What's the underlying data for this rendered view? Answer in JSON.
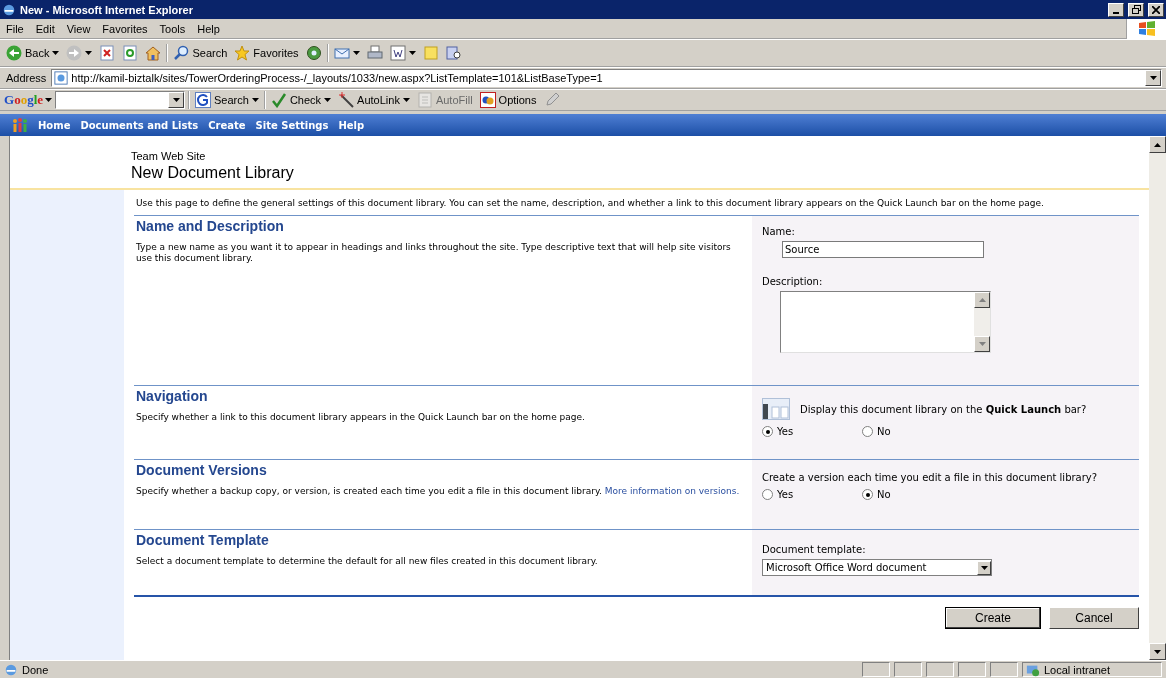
{
  "window": {
    "title": "New - Microsoft Internet Explorer"
  },
  "menu": [
    "File",
    "Edit",
    "View",
    "Favorites",
    "Tools",
    "Help"
  ],
  "toolbar": [
    {
      "kind": "back",
      "label": "Back",
      "dropdown": true
    },
    {
      "kind": "forward",
      "dropdown": true
    },
    {
      "kind": "stop",
      "dropdown": false
    },
    {
      "kind": "refresh",
      "dropdown": false
    },
    {
      "kind": "home",
      "dropdown": false
    },
    {
      "kind": "separator"
    },
    {
      "kind": "search",
      "label": "Search",
      "dropdown": false
    },
    {
      "kind": "favorites",
      "label": "Favorites",
      "dropdown": false
    },
    {
      "kind": "media",
      "dropdown": false
    },
    {
      "kind": "separator"
    },
    {
      "kind": "mail",
      "dropdown": true
    },
    {
      "kind": "print",
      "dropdown": false
    },
    {
      "kind": "word",
      "dropdown": true
    },
    {
      "kind": "note",
      "dropdown": false
    },
    {
      "kind": "research",
      "dropdown": false
    }
  ],
  "address": {
    "label": "Address",
    "url": "http://kamil-biztalk/sites/TowerOrderingProcess-/_layouts/1033/new.aspx?ListTemplate=101&ListBaseType=1"
  },
  "google_toolbar": {
    "logo": "Google",
    "items": [
      {
        "kind": "search",
        "label": "Search",
        "dropdown": true,
        "disabled": false
      },
      {
        "kind": "check",
        "label": "Check",
        "dropdown": true,
        "disabled": false
      },
      {
        "kind": "autolink",
        "label": "AutoLink",
        "dropdown": true,
        "disabled": false
      },
      {
        "kind": "autofill",
        "label": "AutoFill",
        "dropdown": false,
        "disabled": true
      },
      {
        "kind": "options",
        "label": "Options",
        "dropdown": false,
        "disabled": false
      },
      {
        "kind": "pencil",
        "dropdown": false,
        "disabled": false
      }
    ]
  },
  "nav": [
    "Home",
    "Documents and Lists",
    "Create",
    "Site Settings",
    "Help"
  ],
  "header": {
    "site": "Team Web Site",
    "title": "New Document Library"
  },
  "intro": "Use this page to define the general settings of this document library. You can set the name, description, and whether a link to this document library appears on the Quick Launch bar on the home page.",
  "sections": [
    {
      "title": "Name and Description",
      "description": "Type a new name as you want it to appear in headings and links throughout the site. Type descriptive text that will help site visitors use this document library.",
      "controls": [
        {
          "kind": "text",
          "label": "Name:",
          "value": "Source"
        },
        {
          "kind": "textarea",
          "label": "Description:"
        }
      ]
    },
    {
      "title": "Navigation",
      "description": "Specify whether a link to this document library appears in the Quick Launch bar on the home page.",
      "controls": [
        {
          "kind": "radio",
          "icon": true,
          "prompt": "Display this document library on the **Quick Launch** bar?",
          "options": [
            {
              "label": "Yes",
              "selected": true
            },
            {
              "label": "No",
              "selected": false
            }
          ]
        }
      ]
    },
    {
      "title": "Document Versions",
      "description": "Specify whether a backup copy, or version, is created each time you edit a file in this document library.",
      "link": "More information on versions.",
      "controls": [
        {
          "kind": "radio",
          "icon": false,
          "prompt": "Create a version each time you edit a file in this document library?",
          "options": [
            {
              "label": "Yes",
              "selected": false
            },
            {
              "label": "No",
              "selected": true
            }
          ]
        }
      ]
    },
    {
      "title": "Document Template",
      "description": "Select a document template to determine the default for all new files created in this document library.",
      "controls": [
        {
          "kind": "select",
          "label": "Document template:",
          "value": "Microsoft Office Word document"
        }
      ]
    }
  ],
  "buttons": [
    {
      "label": "Create",
      "default": true
    },
    {
      "label": "Cancel",
      "default": false
    }
  ],
  "status_bar": {
    "text": "Done",
    "zone": "Local intranet"
  }
}
